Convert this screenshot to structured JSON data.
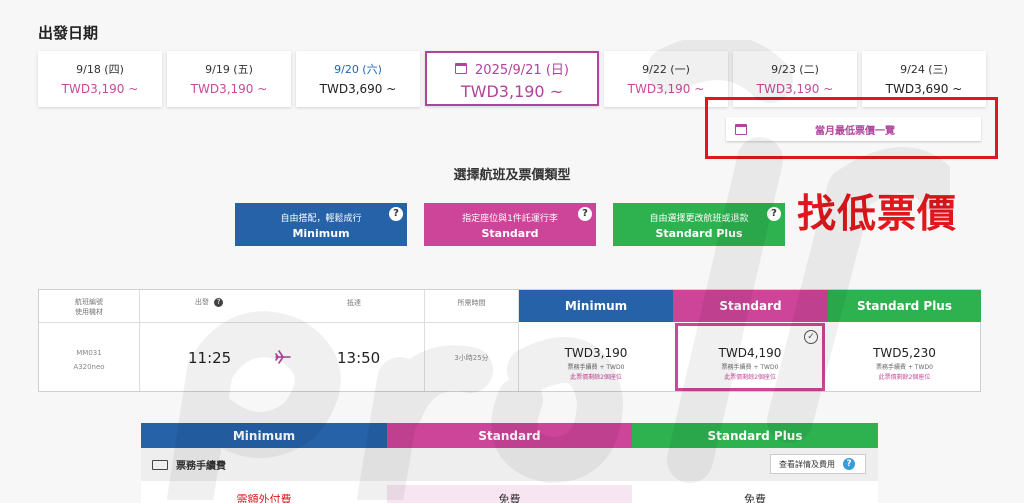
{
  "departure": {
    "title": "出發日期",
    "dates": [
      {
        "date": "9/18 (四)",
        "price": "TWD3,190 ~"
      },
      {
        "date": "9/19 (五)",
        "price": "TWD3,190 ~"
      },
      {
        "date": "9/20 (六)",
        "price": "TWD3,690 ~"
      },
      {
        "date": "2025/9/21 (日)",
        "price": "TWD3,190 ~"
      },
      {
        "date": "9/22 (一)",
        "price": "TWD3,190 ~"
      },
      {
        "date": "9/23 (二)",
        "price": "TWD3,190 ~"
      },
      {
        "date": "9/24 (三)",
        "price": "TWD3,690 ~"
      }
    ],
    "lowest_month_label": "當月最低票價一覽"
  },
  "annotation": "找低票價",
  "fare_types": {
    "title": "選擇航班及票價類型",
    "items": [
      {
        "sub": "自由搭配，輕鬆成行",
        "name": "Minimum"
      },
      {
        "sub": "指定座位與1件託運行李",
        "name": "Standard"
      },
      {
        "sub": "自由選擇更改航班或退款",
        "name": "Standard Plus"
      }
    ],
    "help_glyph": "?"
  },
  "flight_table": {
    "headers": {
      "flight": [
        "航班編號",
        "使用機材"
      ],
      "depart": "出發",
      "arrive": "抵達",
      "duration": "所需時間"
    },
    "fare_headers": [
      "Minimum",
      "Standard",
      "Standard Plus"
    ],
    "flight": {
      "number": "MM031",
      "aircraft": "A320neo",
      "depart_time": "11:25",
      "arrive_time": "13:50",
      "duration": "3小時25分"
    },
    "prices": [
      {
        "amount": "TWD3,190",
        "fee": "票務手續費 + TWD0",
        "seats": "此票價剩餘2個座位"
      },
      {
        "amount": "TWD4,190",
        "fee": "票務手續費 + TWD0",
        "seats": "此票價剩餘2個座位"
      },
      {
        "amount": "TWD5,230",
        "fee": "票務手續費 + TWD0",
        "seats": "此票價剩餘2個座位"
      }
    ],
    "selected_index": 1,
    "check_glyph": "✓"
  },
  "compare": {
    "headers": [
      "Minimum",
      "Standard",
      "Standard Plus"
    ],
    "row_label": "票務手續費",
    "detail_button": "查看詳情及費用",
    "values": [
      "需額外付費",
      "免費",
      "免費"
    ]
  },
  "colors": {
    "minimum": "#2562a8",
    "standard": "#cc4599",
    "standard_plus": "#2db24f",
    "annotation_red": "#e0171d",
    "accent": "#b0439a"
  }
}
